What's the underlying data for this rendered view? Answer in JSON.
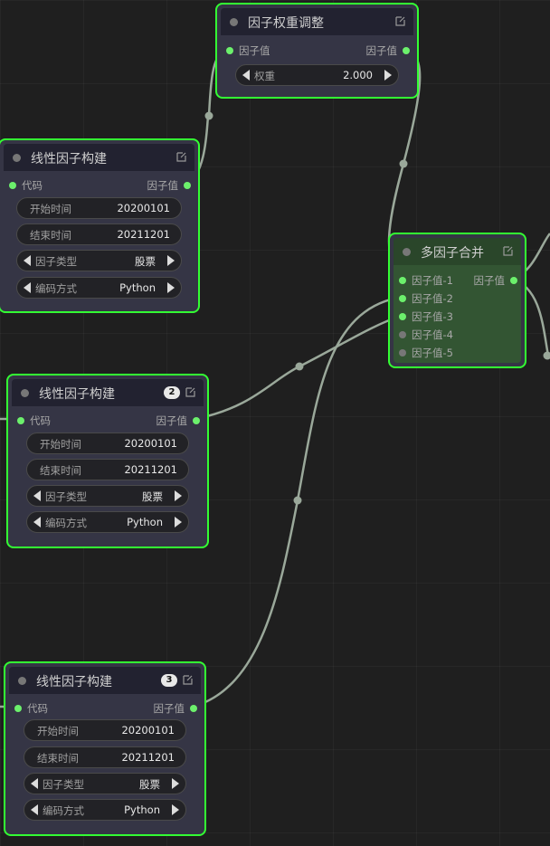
{
  "colors": {
    "canvas_bg": "#1f1f1f",
    "node_body": "#353545",
    "node_title": "#222230",
    "merge_body": "#335533",
    "merge_title": "#2a462a",
    "selected_outline": "#33ff33",
    "link": "#9aa89a",
    "slot_connected": "#6cf06c",
    "slot_empty": "#777777"
  },
  "weight_node": {
    "title": "因子权重调整",
    "input_label": "因子值",
    "output_label": "因子值",
    "widget_label": "权重",
    "widget_value": "2.000"
  },
  "factor_nodes": [
    {
      "title": "线性因子构建",
      "badge": "",
      "input_label": "代码",
      "output_label": "因子值",
      "widgets": [
        {
          "label": "开始时间",
          "value": "20200101",
          "kind": "text"
        },
        {
          "label": "结束时间",
          "value": "20211201",
          "kind": "text"
        },
        {
          "label": "因子类型",
          "value": "股票",
          "kind": "combo"
        },
        {
          "label": "编码方式",
          "value": "Python",
          "kind": "combo"
        }
      ]
    },
    {
      "title": "线性因子构建",
      "badge": "2",
      "input_label": "代码",
      "output_label": "因子值",
      "widgets": [
        {
          "label": "开始时间",
          "value": "20200101",
          "kind": "text"
        },
        {
          "label": "结束时间",
          "value": "20211201",
          "kind": "text"
        },
        {
          "label": "因子类型",
          "value": "股票",
          "kind": "combo"
        },
        {
          "label": "编码方式",
          "value": "Python",
          "kind": "combo"
        }
      ]
    },
    {
      "title": "线性因子构建",
      "badge": "3",
      "input_label": "代码",
      "output_label": "因子值",
      "widgets": [
        {
          "label": "开始时间",
          "value": "20200101",
          "kind": "text"
        },
        {
          "label": "结束时间",
          "value": "20211201",
          "kind": "text"
        },
        {
          "label": "因子类型",
          "value": "股票",
          "kind": "combo"
        },
        {
          "label": "编码方式",
          "value": "Python",
          "kind": "combo"
        }
      ]
    }
  ],
  "merge_node": {
    "title": "多因子合并",
    "output_label": "因子值",
    "inputs": [
      {
        "label": "因子值-1",
        "connected": true
      },
      {
        "label": "因子值-2",
        "connected": true
      },
      {
        "label": "因子值-3",
        "connected": true
      },
      {
        "label": "因子值-4",
        "connected": false
      },
      {
        "label": "因子值-5",
        "connected": false
      }
    ]
  }
}
